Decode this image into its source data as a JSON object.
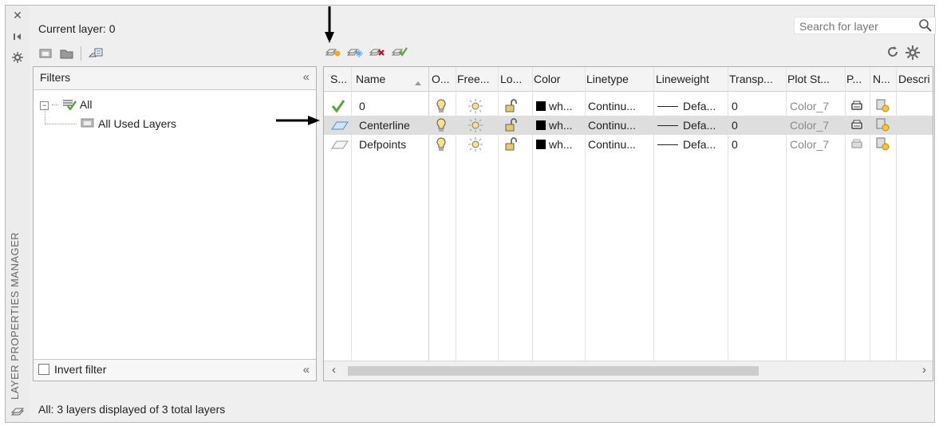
{
  "panel": {
    "title": "LAYER PROPERTIES MANAGER",
    "current_layer": "Current layer: 0",
    "search_placeholder": "Search for layer",
    "status": "All: 3 layers displayed of 3 total layers"
  },
  "filters": {
    "header": "Filters",
    "tree": [
      {
        "label": "All"
      },
      {
        "label": "All Used Layers"
      }
    ],
    "invert_label": "Invert filter"
  },
  "grid": {
    "columns": [
      "S...",
      "Name",
      "O...",
      "Free...",
      "Lo...",
      "Color",
      "Linetype",
      "Lineweight",
      "Transp...",
      "Plot St...",
      "P...",
      "N...",
      "Descri"
    ],
    "rows": [
      {
        "name": "0",
        "color": "wh...",
        "linetype": "Continu...",
        "lineweight": "Defa...",
        "transparency": "0",
        "plot_style": "Color_7",
        "status": "current"
      },
      {
        "name": "Centerline",
        "color": "wh...",
        "linetype": "Continu...",
        "lineweight": "Defa...",
        "transparency": "0",
        "plot_style": "Color_7",
        "status": "selected"
      },
      {
        "name": "Defpoints",
        "color": "wh...",
        "linetype": "Continu...",
        "lineweight": "Defa...",
        "transparency": "0",
        "plot_style": "Color_7",
        "status": "normal"
      }
    ]
  },
  "colors": {
    "current_check": "#5ba33b",
    "selected_row": "#dedede",
    "accent": "#4a90c8"
  }
}
